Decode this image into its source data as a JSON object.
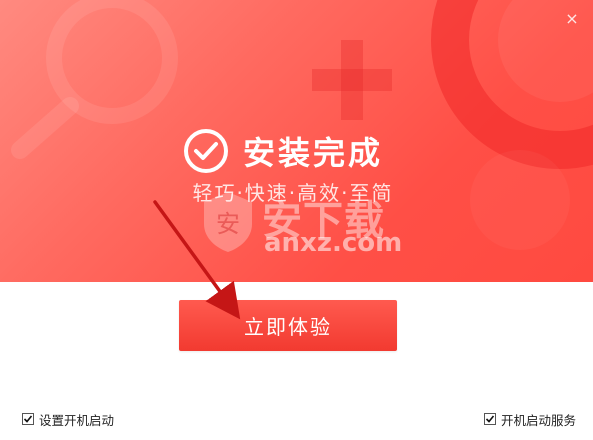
{
  "window": {
    "close_label": "×"
  },
  "banner": {
    "title": "安装完成",
    "subtitle": "轻巧·快速·高效·至简",
    "watermark_cn": "安下载",
    "watermark_en": "anxz.com",
    "watermark_badge": "安",
    "colors": {
      "gradient_start": "#ff8a80",
      "gradient_end": "#ff4a40",
      "button": "#f23a30"
    }
  },
  "actions": {
    "start_label": "立即体验"
  },
  "options": {
    "left": {
      "label": "设置开机启动",
      "checked": true
    },
    "right": {
      "label": "开机启动服务",
      "checked": true
    }
  },
  "icons": {
    "check": "check-circle-icon",
    "close": "close-icon",
    "arrow": "red-arrow-annotation"
  }
}
